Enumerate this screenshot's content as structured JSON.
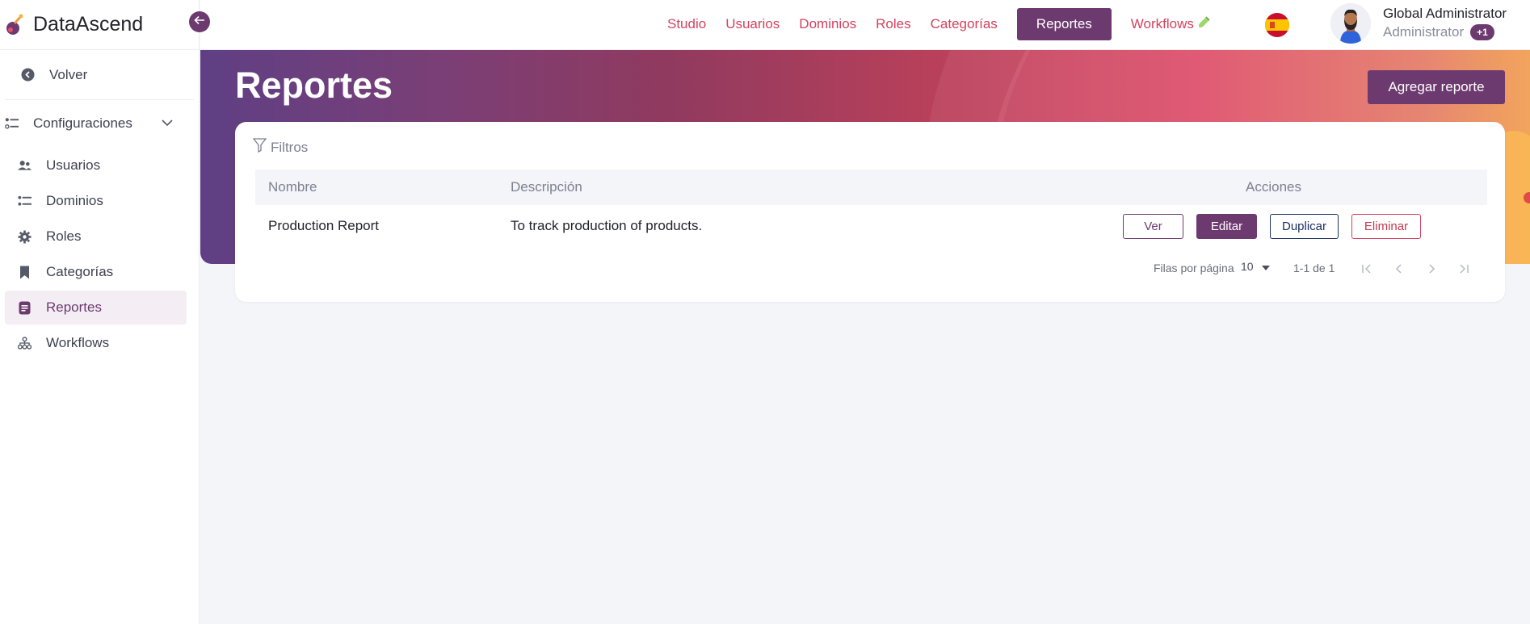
{
  "brand": {
    "name": "DataAscend"
  },
  "sidebar": {
    "back_label": "Volver",
    "group_label": "Configuraciones",
    "items": [
      {
        "label": "Usuarios",
        "icon": "users-icon"
      },
      {
        "label": "Dominios",
        "icon": "list-icon"
      },
      {
        "label": "Roles",
        "icon": "gear-icon"
      },
      {
        "label": "Categorías",
        "icon": "bookmark-icon"
      },
      {
        "label": "Reportes",
        "icon": "report-icon",
        "active": true
      },
      {
        "label": "Workflows",
        "icon": "workflow-icon"
      }
    ]
  },
  "nav": {
    "items": [
      "Studio",
      "Usuarios",
      "Dominios",
      "Roles",
      "Categorías",
      "Reportes",
      "Workflows"
    ],
    "active": "Reportes"
  },
  "user": {
    "name": "Global Administrator",
    "role": "Administrator",
    "extra_roles": "+1"
  },
  "page": {
    "title": "Reportes",
    "add_button": "Agregar reporte"
  },
  "filters": {
    "label": "Filtros"
  },
  "table": {
    "columns": [
      "Nombre",
      "Descripción",
      "Acciones"
    ],
    "rows": [
      {
        "name": "Production Report",
        "description": "To track production of products."
      }
    ],
    "actions": {
      "view": "Ver",
      "edit": "Editar",
      "duplicate": "Duplicar",
      "delete": "Eliminar"
    }
  },
  "pagination": {
    "rows_per_page_label": "Filas por página",
    "rows_per_page": "10",
    "range": "1-1 de 1"
  },
  "colors": {
    "primary": "#6d3a6f",
    "accent": "#d3425e",
    "navy": "#1d3160"
  }
}
